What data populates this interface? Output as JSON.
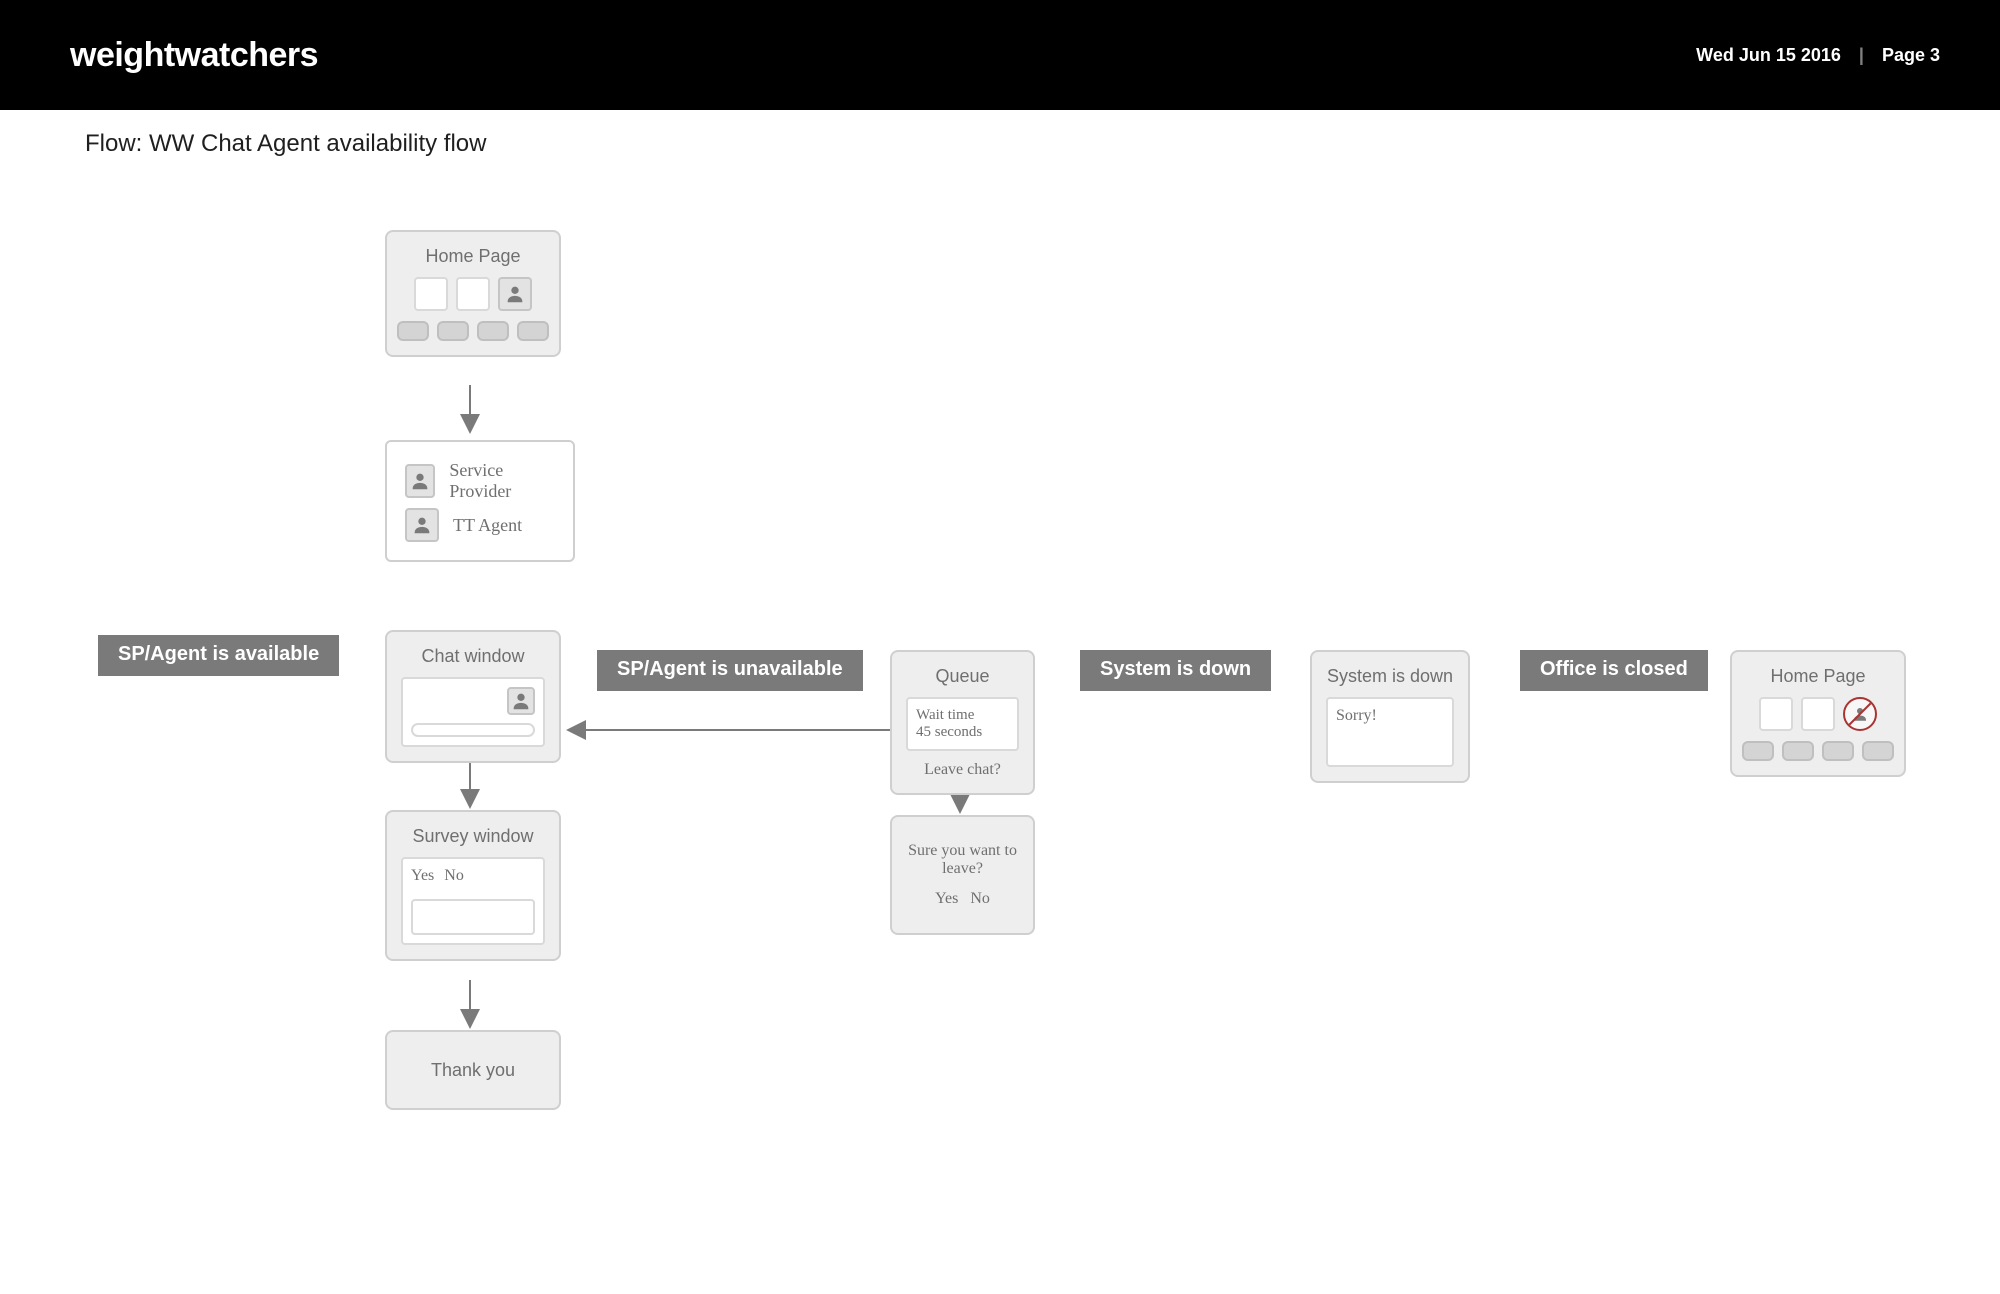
{
  "header": {
    "brand": "weightwatchers",
    "date": "Wed Jun 15 2016",
    "page_label": "Page 3"
  },
  "flow_title": "Flow: WW Chat Agent availability flow",
  "labels": {
    "available": "SP/Agent is available",
    "unavailable": "SP/Agent is unavailable",
    "system_down": "System is down",
    "office_closed": "Office is closed"
  },
  "nodes": {
    "home1": {
      "title": "Home Page"
    },
    "agent_select": {
      "row1": "Service Provider",
      "row2": "TT Agent"
    },
    "chat_window": {
      "title": "Chat window"
    },
    "survey_window": {
      "title": "Survey window",
      "yes": "Yes",
      "no": "No"
    },
    "thank_you": {
      "title": "Thank you"
    },
    "queue": {
      "title": "Queue",
      "wait_line1": "Wait time",
      "wait_line2": "45 seconds",
      "leave": "Leave chat?"
    },
    "leave_confirm": {
      "title": "Sure you want to leave?",
      "yes": "Yes",
      "no": "No"
    },
    "system_down_box": {
      "title": "System is down",
      "body": "Sorry!"
    },
    "home2": {
      "title": "Home Page"
    }
  }
}
